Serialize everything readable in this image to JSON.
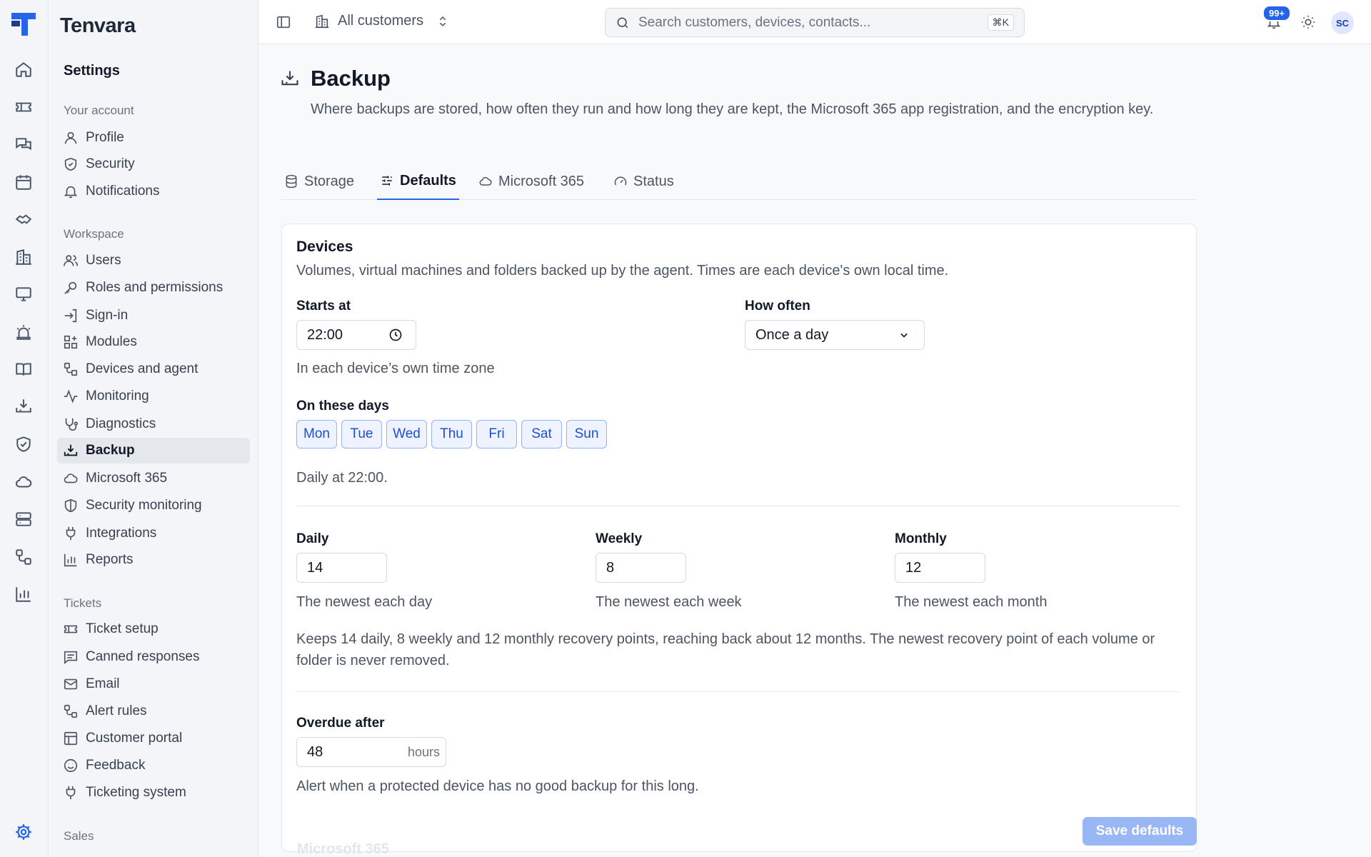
{
  "app": {
    "brand": "Tenvara"
  },
  "rail": {
    "icons": [
      "home-icon",
      "ticket-icon",
      "chat-icon",
      "calendar-icon",
      "handshake-icon",
      "building-icon",
      "monitor-icon",
      "siren-icon",
      "book-icon",
      "backup-icon",
      "shield-check-icon",
      "cloud-icon",
      "server-icon",
      "workflow-icon",
      "bar-chart-icon",
      "gear-icon"
    ]
  },
  "sidebar": {
    "title": "Settings",
    "sections": [
      {
        "label": "Your account",
        "items": [
          "Profile",
          "Security",
          "Notifications"
        ]
      },
      {
        "label": "Workspace",
        "items": [
          "Users",
          "Roles and permissions",
          "Sign-in",
          "Modules",
          "Devices and agent",
          "Monitoring",
          "Diagnostics",
          "Backup",
          "Microsoft 365",
          "Security monitoring",
          "Integrations",
          "Reports"
        ]
      },
      {
        "label": "Tickets",
        "items": [
          "Ticket setup",
          "Canned responses",
          "Email",
          "Alert rules",
          "Customer portal",
          "Feedback",
          "Ticketing system"
        ]
      },
      {
        "label": "Sales",
        "items": []
      }
    ],
    "active": "Backup"
  },
  "topbar": {
    "customer_scope": "All customers",
    "search_placeholder": "Search customers, devices, contacts...",
    "search_shortcut": "⌘K",
    "notifications_badge": "99+",
    "avatar_initials": "SC"
  },
  "page": {
    "title": "Backup",
    "description": "Where backups are stored, how often they run and how long they are kept, the Microsoft 365 app registration, and the encryption key.",
    "tabs": [
      "Storage",
      "Defaults",
      "Microsoft 365",
      "Status"
    ],
    "active_tab": "Defaults"
  },
  "devices": {
    "title": "Devices",
    "description": "Volumes, virtual machines and folders backed up by the agent. Times are each device's own local time.",
    "starts_at_label": "Starts at",
    "starts_at_value": "22:00",
    "starts_at_hint": "In each device’s own time zone",
    "how_often_label": "How often",
    "how_often_value": "Once a day",
    "days_label": "On these days",
    "days": [
      "Mon",
      "Tue",
      "Wed",
      "Thu",
      "Fri",
      "Sat",
      "Sun"
    ],
    "schedule_summary": "Daily at 22:00.",
    "retention": [
      {
        "label": "Daily",
        "value": "14",
        "hint": "The newest each day"
      },
      {
        "label": "Weekly",
        "value": "8",
        "hint": "The newest each week"
      },
      {
        "label": "Monthly",
        "value": "12",
        "hint": "The newest each month"
      }
    ],
    "retention_summary": "Keeps 14 daily, 8 weekly and 12 monthly recovery points, reaching back about 12 months. The newest recovery point of each volume or folder is never removed.",
    "overdue_label": "Overdue after",
    "overdue_value": "48",
    "overdue_unit": "hours",
    "overdue_hint": "Alert when a protected device has no good backup for this long."
  },
  "footer": {
    "save_label": "Save defaults",
    "next_section_peek": "Microsoft 365"
  },
  "colors": {
    "accent": "#2563eb",
    "active_nav_bg": "#e4e7ec"
  }
}
